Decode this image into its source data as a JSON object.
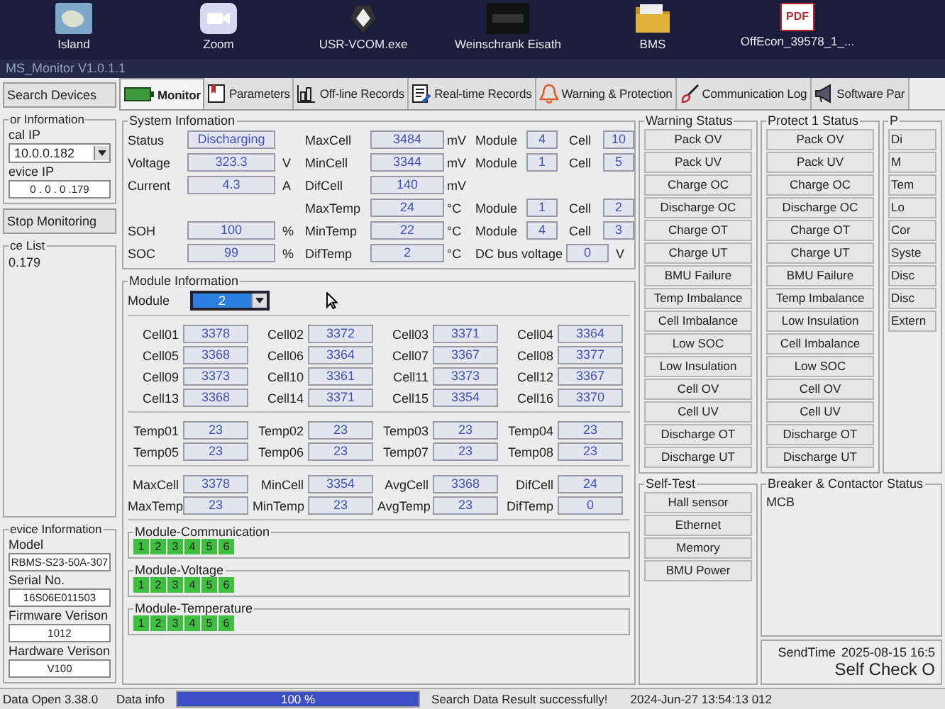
{
  "desktop_icons": [
    {
      "kind": "map",
      "label": "Island"
    },
    {
      "kind": "video",
      "label": "Zoom"
    },
    {
      "kind": "app",
      "label": "USR-VCOM.exe"
    },
    {
      "kind": "window",
      "label": "Weinschrank Eisath"
    },
    {
      "kind": "folder",
      "label": "BMS"
    },
    {
      "kind": "pdf",
      "badge": "PDF",
      "label": "OffEcon_39578_1_..."
    }
  ],
  "window": {
    "title": "MS_Monitor V1.0.1.1"
  },
  "sidebar": {
    "search_button": "Search Devices",
    "connection": {
      "title": "or Information",
      "local_ip_label": "cal IP",
      "local_ip": "10.0.0.182",
      "device_ip_label": "evice IP",
      "device_ip": "0 . 0 . 0 .179"
    },
    "stop_button": "Stop Monitoring",
    "device_list": {
      "title": "ce List",
      "items": [
        "0.179"
      ]
    },
    "device_info": {
      "title": "evice Information",
      "fields": [
        {
          "label": "Model",
          "value": "RBMS-S23-50A-307"
        },
        {
          "label": "Serial No.",
          "value": "16S06E011503"
        },
        {
          "label": "Firmware Verison",
          "value": "1012"
        },
        {
          "label": "Hardware Verison",
          "value": "V100"
        }
      ]
    }
  },
  "tabs": [
    {
      "kind": "battery",
      "label": "Monitor",
      "selected": true
    },
    {
      "kind": "book",
      "label": "Parameters",
      "selected": false
    },
    {
      "kind": "chart",
      "label": "Off-line Records",
      "selected": false
    },
    {
      "kind": "document",
      "label": "Real-time Records",
      "selected": false
    },
    {
      "kind": "bell",
      "label": "Warning & Protection",
      "selected": false
    },
    {
      "kind": "brush",
      "label": "Communication Log",
      "selected": false
    },
    {
      "kind": "megaphone",
      "label": "Software Par",
      "selected": false
    }
  ],
  "system_information": {
    "title": "System Infomation",
    "pack": [
      {
        "label": "Status",
        "value": "Discharging"
      },
      {
        "label": "Voltage",
        "value": "323.3",
        "unit": "V"
      },
      {
        "label": "Current",
        "value": "4.3",
        "unit": "A"
      }
    ],
    "health": [
      {
        "label": "SOH",
        "value": "100",
        "unit": "%"
      },
      {
        "label": "SOC",
        "value": "99",
        "unit": "%"
      }
    ],
    "extremes": [
      {
        "label": "MaxCell",
        "value": "3484",
        "unit": "mV",
        "module_label": "Module",
        "module": "4",
        "cell_label": "Cell",
        "cell": "10"
      },
      {
        "label": "MinCell",
        "value": "3344",
        "unit": "mV",
        "module_label": "Module",
        "module": "1",
        "cell_label": "Cell",
        "cell": "5"
      },
      {
        "label": "DifCell",
        "value": "140",
        "unit": "mV"
      },
      {
        "label": "MaxTemp",
        "value": "24",
        "unit": "°C",
        "module_label": "Module",
        "module": "1",
        "cell_label": "Cell",
        "cell": "2"
      },
      {
        "label": "MinTemp",
        "value": "22",
        "unit": "°C",
        "module_label": "Module",
        "module": "4",
        "cell_label": "Cell",
        "cell": "3"
      },
      {
        "label": "DifTemp",
        "value": "2",
        "unit": "°C"
      }
    ],
    "dc_bus": {
      "label": "DC bus voltage",
      "value": "0",
      "unit": "V"
    }
  },
  "module_information": {
    "title": "Module Information",
    "module_select": {
      "label": "Module",
      "value": "2"
    },
    "cells": [
      {
        "label": "Cell01",
        "value": "3378"
      },
      {
        "label": "Cell02",
        "value": "3372"
      },
      {
        "label": "Cell03",
        "value": "3371"
      },
      {
        "label": "Cell04",
        "value": "3364"
      },
      {
        "label": "Cell05",
        "value": "3368"
      },
      {
        "label": "Cell06",
        "value": "3364"
      },
      {
        "label": "Cell07",
        "value": "3367"
      },
      {
        "label": "Cell08",
        "value": "3377"
      },
      {
        "label": "Cell09",
        "value": "3373"
      },
      {
        "label": "Cell10",
        "value": "3361"
      },
      {
        "label": "Cell11",
        "value": "3373"
      },
      {
        "label": "Cell12",
        "value": "3367"
      },
      {
        "label": "Cell13",
        "value": "3368"
      },
      {
        "label": "Cell14",
        "value": "3371"
      },
      {
        "label": "Cell15",
        "value": "3354"
      },
      {
        "label": "Cell16",
        "value": "3370"
      }
    ],
    "temps": [
      {
        "label": "Temp01",
        "value": "23"
      },
      {
        "label": "Temp02",
        "value": "23"
      },
      {
        "label": "Temp03",
        "value": "23"
      },
      {
        "label": "Temp04",
        "value": "23"
      },
      {
        "label": "Temp05",
        "value": "23"
      },
      {
        "label": "Temp06",
        "value": "23"
      },
      {
        "label": "Temp07",
        "value": "23"
      },
      {
        "label": "Temp08",
        "value": "23"
      }
    ],
    "stats": [
      {
        "label": "MaxCell",
        "value": "3378"
      },
      {
        "label": "MinCell",
        "value": "3354"
      },
      {
        "label": "AvgCell",
        "value": "3368"
      },
      {
        "label": "DifCell",
        "value": "24"
      },
      {
        "label": "MaxTemp",
        "value": "23"
      },
      {
        "label": "MinTemp",
        "value": "23"
      },
      {
        "label": "AvgTemp",
        "value": "23"
      },
      {
        "label": "DifTemp",
        "value": "0"
      }
    ],
    "status_groups": [
      {
        "title": "Module-Communication",
        "items": [
          {
            "label": "1",
            "on": true
          },
          {
            "label": "2",
            "on": true
          },
          {
            "label": "3",
            "on": true
          },
          {
            "label": "4",
            "on": true
          },
          {
            "label": "5",
            "on": true
          },
          {
            "label": "6",
            "on": true
          }
        ]
      },
      {
        "title": "Module-Voltage",
        "items": [
          {
            "label": "1",
            "on": true
          },
          {
            "label": "2",
            "on": true
          },
          {
            "label": "3",
            "on": true
          },
          {
            "label": "4",
            "on": true
          },
          {
            "label": "5",
            "on": true
          },
          {
            "label": "6",
            "on": true
          }
        ]
      },
      {
        "title": "Module-Temperature",
        "items": [
          {
            "label": "1",
            "on": true
          },
          {
            "label": "2",
            "on": true
          },
          {
            "label": "3",
            "on": true
          },
          {
            "label": "4",
            "on": true
          },
          {
            "label": "5",
            "on": true
          },
          {
            "label": "6",
            "on": true
          }
        ]
      }
    ]
  },
  "warning_status": {
    "title": "Warning Status",
    "items": [
      "Pack OV",
      "Pack UV",
      "Charge OC",
      "Discharge OC",
      "Charge OT",
      "Charge UT",
      "BMU Failure",
      "Temp Imbalance",
      "Cell Imbalance",
      "Low SOC",
      "Low Insulation",
      "Cell OV",
      "Cell UV",
      "Discharge OT",
      "Discharge UT"
    ]
  },
  "protect_1_status": {
    "title": "Protect 1 Status",
    "items": [
      "Pack OV",
      "Pack UV",
      "Charge OC",
      "Discharge OC",
      "Charge OT",
      "Charge UT",
      "BMU Failure",
      "Temp Imbalance",
      "Low Insulation",
      "Cell Imbalance",
      "Low SOC",
      "Cell OV",
      "Cell UV",
      "Discharge OT",
      "Discharge UT"
    ]
  },
  "column_3": {
    "title": "P",
    "items": [
      "Di",
      "M",
      "Tem",
      "Lo",
      "Cor",
      "Syste",
      "Disc",
      "Disc",
      "Extern"
    ]
  },
  "self_test": {
    "title": "Self-Test",
    "items": [
      "Hall sensor",
      "Ethernet",
      "Memory",
      "BMU Power"
    ]
  },
  "breaker_contactor_status": {
    "title": "Breaker & Contactor Status",
    "items": [
      "MCB"
    ]
  },
  "self_check": {
    "send_time_label": "SendTime",
    "send_time": "2025-08-15 16:5",
    "message": "Self Check O"
  },
  "status_bar": {
    "version": "Data Open 3.38.0",
    "data_info_label": "Data info",
    "progress": {
      "level": 1,
      "text": "100 %"
    },
    "message": "Search Data Result successfully!",
    "timestamp": "2024-Jun-27 13:54:13 012"
  }
}
